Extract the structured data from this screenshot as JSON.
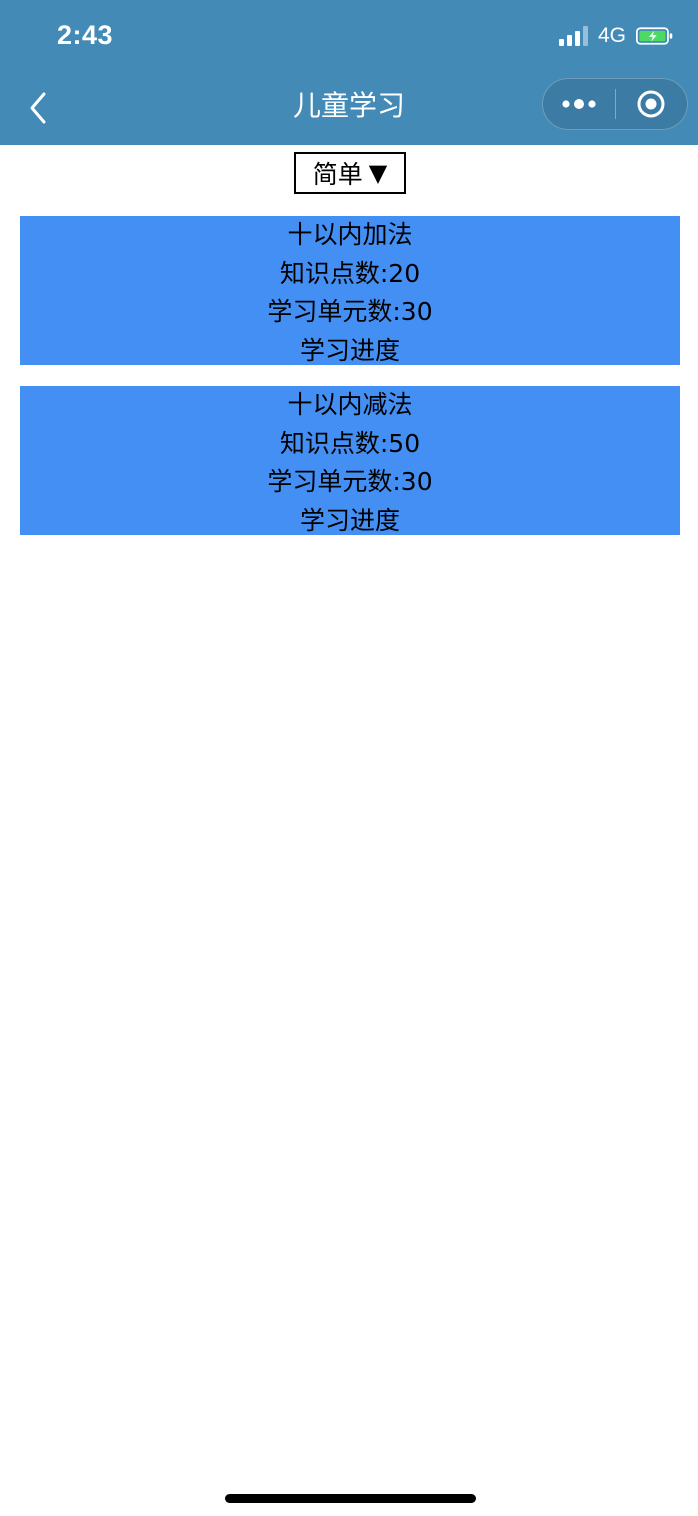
{
  "status_bar": {
    "time": "2:43",
    "network": "4G",
    "signal_bars": 4,
    "signal_active": 3,
    "battery": "charging"
  },
  "nav": {
    "title": "儿童学习",
    "back_icon": "chevron-left-icon",
    "more_icon": "more-dots-icon",
    "close_icon": "target-close-icon"
  },
  "difficulty_picker": {
    "selected": "简单",
    "arrow": "▼"
  },
  "courses": [
    {
      "name": "十以内加法",
      "knowledge_points": "知识点数:20",
      "units": "学习单元数:30",
      "progress_label": "学习进度"
    },
    {
      "name": "十以内减法",
      "knowledge_points": "知识点数:50",
      "units": "学习单元数:30",
      "progress_label": "学习进度"
    }
  ],
  "colors": {
    "header_bg": "#438ab6",
    "card_bg": "#438ff4",
    "battery_fill": "#4cd964"
  }
}
